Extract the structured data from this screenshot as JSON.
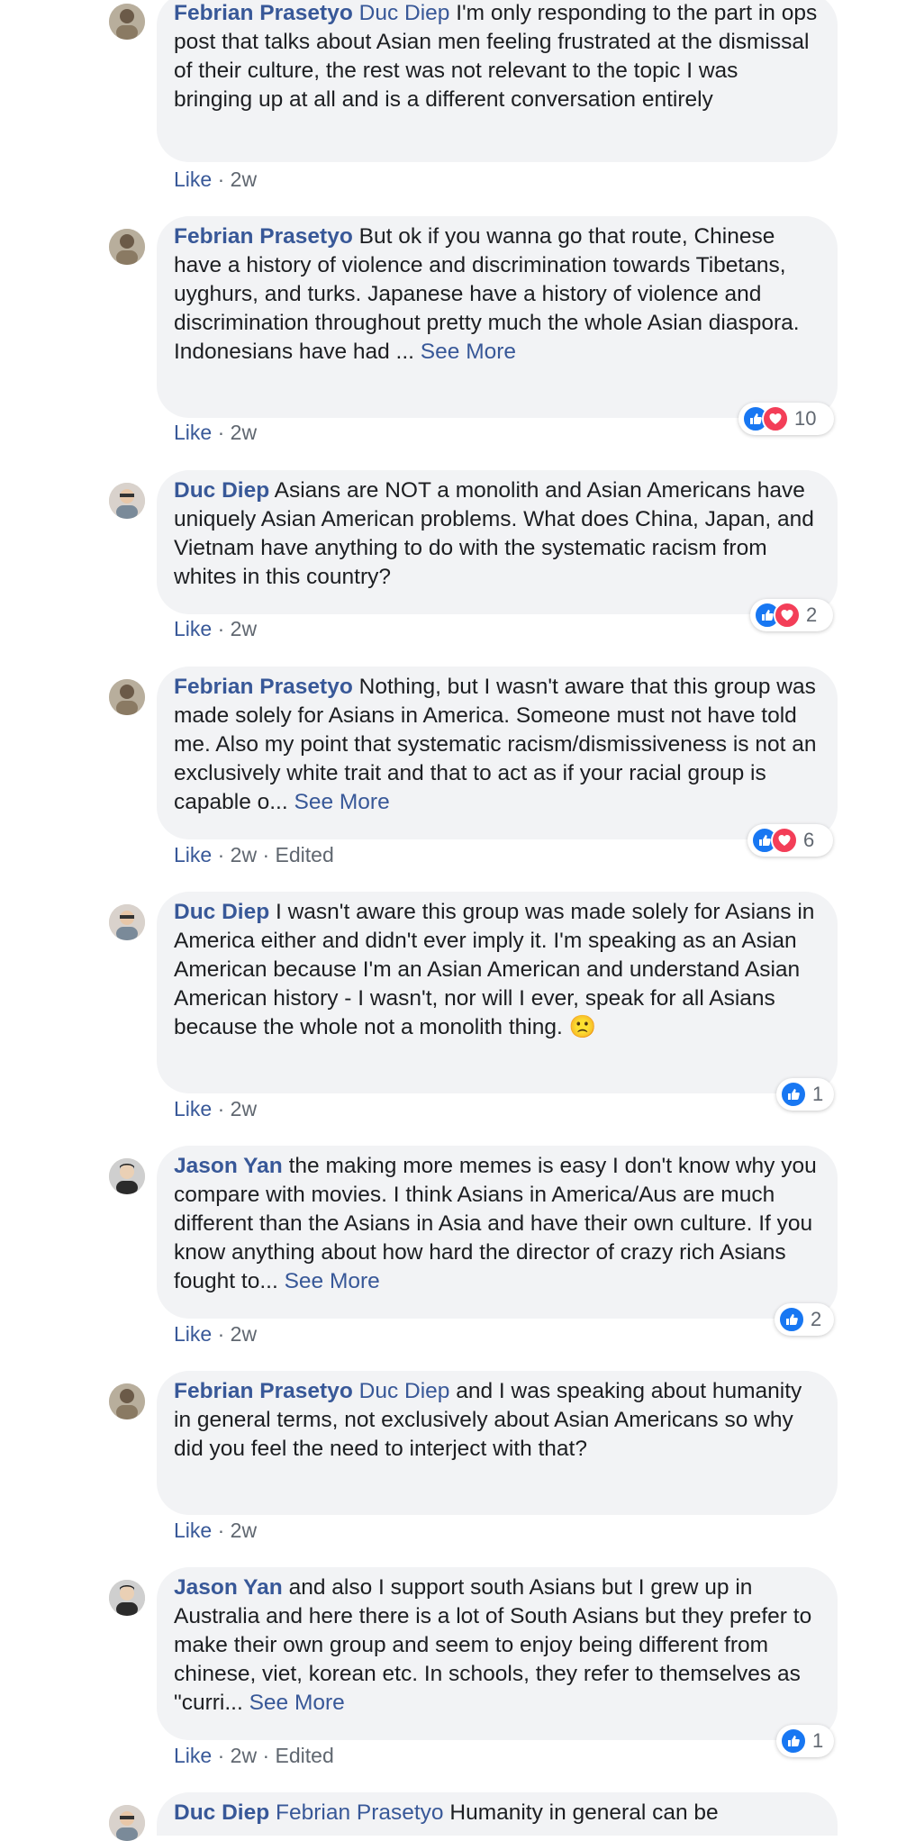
{
  "comments": [
    {
      "author": "Febrian Prasetyo",
      "mention": "Duc Diep",
      "text": " I'm only responding to the part in ops post that talks about Asian men feeling frustrated at the dismissal of their culture, the rest was not relevant to the topic I was bringing up at all and is a different conversation entirely",
      "see_more": "",
      "like": "Like",
      "time": "2w",
      "edited": "",
      "reaction_count": ""
    },
    {
      "author": "Febrian Prasetyo",
      "mention": "",
      "text": " But ok if you wanna go that route, Chinese have a history of violence and discrimination towards Tibetans, uyghurs, and turks. Japanese have a history of violence and discrimination throughout pretty much the whole Asian diaspora. Indonesians have had ...",
      "see_more": "See More",
      "like": "Like",
      "time": "2w",
      "edited": "",
      "reaction_count": "10"
    },
    {
      "author": "Duc Diep",
      "mention": "",
      "text": " Asians are NOT a monolith and Asian Americans have uniquely Asian American problems. What does China, Japan, and Vietnam have anything to do with the systematic racism from whites in this country?",
      "see_more": "",
      "like": "Like",
      "time": "2w",
      "edited": "",
      "reaction_count": "2"
    },
    {
      "author": "Febrian Prasetyo",
      "mention": "",
      "text": " Nothing, but I wasn't aware that this group was made solely for Asians in America. Someone must not have told me. Also my point that systematic racism/dismissiveness is not an exclusively white trait and that to act as if your racial group is capable o...",
      "see_more": "See More",
      "like": "Like",
      "time": "2w",
      "edited": "Edited",
      "reaction_count": "6"
    },
    {
      "author": "Duc Diep",
      "mention": "",
      "text": " I wasn't aware this group was made solely for Asians in America either and didn't ever imply it. I'm speaking as an Asian American because I'm an Asian American and understand Asian American history - I wasn't, nor will I ever, speak for all Asians because the whole not a monolith thing. 🙁",
      "see_more": "",
      "like": "Like",
      "time": "2w",
      "edited": "",
      "reaction_count": "1"
    },
    {
      "author": "Jason Yan",
      "mention": "",
      "text": " the making more memes is easy I don't know why you compare with movies. I think Asians in America/Aus are much different than the Asians in Asia and have their own culture. If you know anything about how hard the director of crazy rich Asians fought to...",
      "see_more": "See More",
      "like": "Like",
      "time": "2w",
      "edited": "",
      "reaction_count": "2"
    },
    {
      "author": "Febrian Prasetyo",
      "mention": "Duc Diep",
      "text": " and I was speaking about humanity in general terms, not exclusively about Asian Americans so why did you feel the need to interject with that?",
      "see_more": "",
      "like": "Like",
      "time": "2w",
      "edited": "",
      "reaction_count": ""
    },
    {
      "author": "Jason Yan",
      "mention": "",
      "text": " and also I support south Asians but I grew up in Australia and here there is a lot of South Asians but they prefer to make their own group and seem to enjoy being different from chinese, viet, korean etc. In schools, they refer to themselves as \"curri...",
      "see_more": "See More",
      "like": "Like",
      "time": "2w",
      "edited": "Edited",
      "reaction_count": "1"
    },
    {
      "author": "Duc Diep",
      "mention": "Febrian Prasetyo",
      "text": " Humanity in general can be",
      "see_more": "",
      "like": "",
      "time": "",
      "edited": "",
      "reaction_count": ""
    }
  ],
  "reaction_icons": [
    "like-icon",
    "love-icon"
  ],
  "colors": {
    "link": "#385898",
    "bubble": "#f2f3f5",
    "meta": "#606770",
    "like_blue": "#1877f2",
    "love_red": "#f33e58"
  }
}
